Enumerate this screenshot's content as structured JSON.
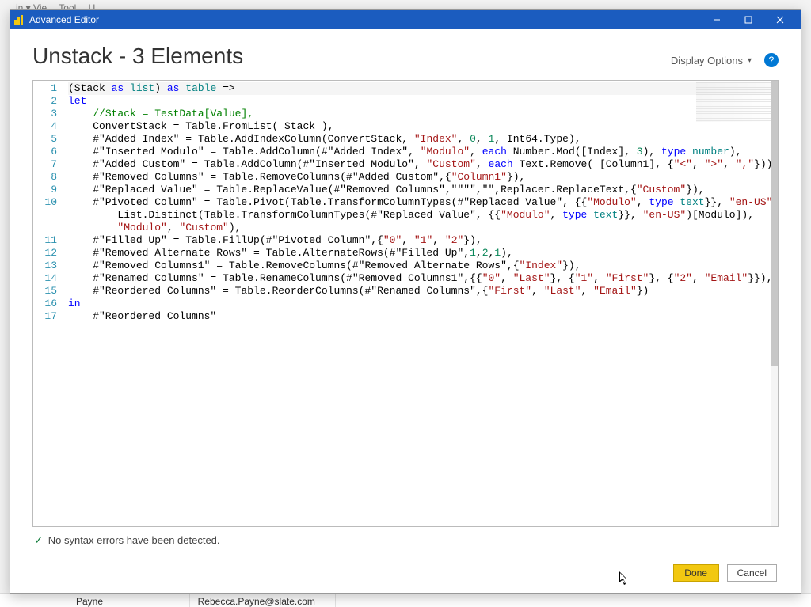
{
  "bg": {
    "menu_hint": "in ▾   Vie…   Tool…   U…",
    "row_cell_a": "Payne",
    "row_cell_b": "Rebecca.Payne@slate.com"
  },
  "titlebar": {
    "title": "Advanced Editor"
  },
  "header": {
    "page_title": "Unstack - 3 Elements",
    "display_options": "Display Options",
    "help_tooltip": "?"
  },
  "status": {
    "text": "No syntax errors have been detected."
  },
  "buttons": {
    "done": "Done",
    "cancel": "Cancel"
  },
  "code": {
    "lines": [
      {
        "n": 1,
        "tokens": [
          [
            "id",
            "(Stack "
          ],
          [
            "kw",
            "as"
          ],
          [
            "id",
            " "
          ],
          [
            "ty",
            "list"
          ],
          [
            "id",
            ") "
          ],
          [
            "kw",
            "as"
          ],
          [
            "id",
            " "
          ],
          [
            "ty",
            "table"
          ],
          [
            "id",
            " =>"
          ]
        ]
      },
      {
        "n": 2,
        "tokens": [
          [
            "kw",
            "let"
          ]
        ]
      },
      {
        "n": 3,
        "tokens": [
          [
            "id",
            "    "
          ],
          [
            "cmt",
            "//Stack = TestData[Value],"
          ]
        ]
      },
      {
        "n": 4,
        "tokens": [
          [
            "id",
            "    ConvertStack = Table.FromList( Stack ),"
          ]
        ]
      },
      {
        "n": 5,
        "tokens": [
          [
            "id",
            "    #\"Added Index\" = Table.AddIndexColumn(ConvertStack, "
          ],
          [
            "str",
            "\"Index\""
          ],
          [
            "id",
            ", "
          ],
          [
            "num",
            "0"
          ],
          [
            "id",
            ", "
          ],
          [
            "num",
            "1"
          ],
          [
            "id",
            ", Int64.Type),"
          ]
        ]
      },
      {
        "n": 6,
        "tokens": [
          [
            "id",
            "    #\"Inserted Modulo\" = Table.AddColumn(#\"Added Index\", "
          ],
          [
            "str",
            "\"Modulo\""
          ],
          [
            "id",
            ", "
          ],
          [
            "kw",
            "each"
          ],
          [
            "id",
            " Number.Mod([Index], "
          ],
          [
            "num",
            "3"
          ],
          [
            "id",
            "), "
          ],
          [
            "kw",
            "type"
          ],
          [
            "id",
            " "
          ],
          [
            "ty",
            "number"
          ],
          [
            "id",
            "),"
          ]
        ]
      },
      {
        "n": 7,
        "tokens": [
          [
            "id",
            "    #\"Added Custom\" = Table.AddColumn(#\"Inserted Modulo\", "
          ],
          [
            "str",
            "\"Custom\""
          ],
          [
            "id",
            ", "
          ],
          [
            "kw",
            "each"
          ],
          [
            "id",
            " Text.Remove( [Column1], {"
          ],
          [
            "str",
            "\"<\""
          ],
          [
            "id",
            ", "
          ],
          [
            "str",
            "\">\""
          ],
          [
            "id",
            ", "
          ],
          [
            "str",
            "\",\""
          ],
          [
            "id",
            "})),"
          ]
        ]
      },
      {
        "n": 8,
        "tokens": [
          [
            "id",
            "    #\"Removed Columns\" = Table.RemoveColumns(#\"Added Custom\",{"
          ],
          [
            "str",
            "\"Column1\""
          ],
          [
            "id",
            "}),"
          ]
        ]
      },
      {
        "n": 9,
        "tokens": [
          [
            "id",
            "    #\"Replaced Value\" = Table.ReplaceValue(#\"Removed Columns\",\"\"\"\",\"\",Replacer.ReplaceText,{"
          ],
          [
            "str",
            "\"Custom\""
          ],
          [
            "id",
            "}),"
          ]
        ]
      },
      {
        "n": 10,
        "tokens": [
          [
            "id",
            "    #\"Pivoted Column\" = Table.Pivot(Table.TransformColumnTypes(#\"Replaced Value\", {{"
          ],
          [
            "str",
            "\"Modulo\""
          ],
          [
            "id",
            ", "
          ],
          [
            "kw",
            "type"
          ],
          [
            "id",
            " "
          ],
          [
            "ty",
            "text"
          ],
          [
            "id",
            "}}, "
          ],
          [
            "str",
            "\"en-US\""
          ],
          [
            "id",
            "),"
          ]
        ]
      },
      {
        "n": 10,
        "cont": true,
        "tokens": [
          [
            "id",
            "        List.Distinct(Table.TransformColumnTypes(#\"Replaced Value\", {{"
          ],
          [
            "str",
            "\"Modulo\""
          ],
          [
            "id",
            ", "
          ],
          [
            "kw",
            "type"
          ],
          [
            "id",
            " "
          ],
          [
            "ty",
            "text"
          ],
          [
            "id",
            "}}, "
          ],
          [
            "str",
            "\"en-US\""
          ],
          [
            "id",
            ")[Modulo]),"
          ]
        ]
      },
      {
        "n": 10,
        "cont": true,
        "tokens": [
          [
            "id",
            "        "
          ],
          [
            "str",
            "\"Modulo\""
          ],
          [
            "id",
            ", "
          ],
          [
            "str",
            "\"Custom\""
          ],
          [
            "id",
            "),"
          ]
        ]
      },
      {
        "n": 11,
        "tokens": [
          [
            "id",
            "    #\"Filled Up\" = Table.FillUp(#\"Pivoted Column\",{"
          ],
          [
            "str",
            "\"0\""
          ],
          [
            "id",
            ", "
          ],
          [
            "str",
            "\"1\""
          ],
          [
            "id",
            ", "
          ],
          [
            "str",
            "\"2\""
          ],
          [
            "id",
            "}),"
          ]
        ]
      },
      {
        "n": 12,
        "tokens": [
          [
            "id",
            "    #\"Removed Alternate Rows\" = Table.AlternateRows(#\"Filled Up\","
          ],
          [
            "num",
            "1"
          ],
          [
            "id",
            ","
          ],
          [
            "num",
            "2"
          ],
          [
            "id",
            ","
          ],
          [
            "num",
            "1"
          ],
          [
            "id",
            "),"
          ]
        ]
      },
      {
        "n": 13,
        "tokens": [
          [
            "id",
            "    #\"Removed Columns1\" = Table.RemoveColumns(#\"Removed Alternate Rows\",{"
          ],
          [
            "str",
            "\"Index\""
          ],
          [
            "id",
            "}),"
          ]
        ]
      },
      {
        "n": 14,
        "tokens": [
          [
            "id",
            "    #\"Renamed Columns\" = Table.RenameColumns(#\"Removed Columns1\",{{"
          ],
          [
            "str",
            "\"0\""
          ],
          [
            "id",
            ", "
          ],
          [
            "str",
            "\"Last\""
          ],
          [
            "id",
            "}, {"
          ],
          [
            "str",
            "\"1\""
          ],
          [
            "id",
            ", "
          ],
          [
            "str",
            "\"First\""
          ],
          [
            "id",
            "}, {"
          ],
          [
            "str",
            "\"2\""
          ],
          [
            "id",
            ", "
          ],
          [
            "str",
            "\"Email\""
          ],
          [
            "id",
            "}}),"
          ]
        ]
      },
      {
        "n": 15,
        "tokens": [
          [
            "id",
            "    #\"Reordered Columns\" = Table.ReorderColumns(#\"Renamed Columns\",{"
          ],
          [
            "str",
            "\"First\""
          ],
          [
            "id",
            ", "
          ],
          [
            "str",
            "\"Last\""
          ],
          [
            "id",
            ", "
          ],
          [
            "str",
            "\"Email\""
          ],
          [
            "id",
            "})"
          ]
        ]
      },
      {
        "n": 16,
        "tokens": [
          [
            "kw",
            "in"
          ]
        ]
      },
      {
        "n": 17,
        "tokens": [
          [
            "id",
            "    #\"Reordered Columns\""
          ]
        ]
      }
    ]
  }
}
